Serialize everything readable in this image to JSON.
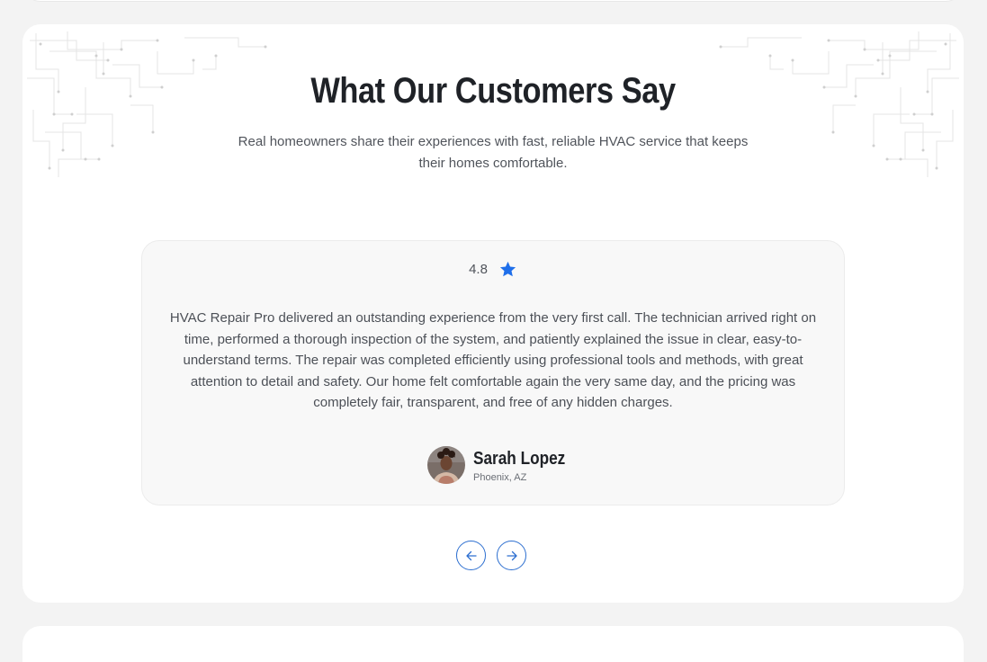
{
  "section": {
    "title": "What Our Customers Say",
    "subtitle": "Real homeowners share their experiences with fast, reliable HVAC service that keeps their homes comfortable."
  },
  "testimonial": {
    "rating": "4.8",
    "rating_icon": "star-icon",
    "quote": "HVAC Repair Pro delivered an outstanding experience from the very first call. The technician arrived right on time, performed a thorough inspection of the system, and patiently explained the issue in clear, easy-to-understand terms. The repair was completed efficiently using professional tools and methods, with great attention to detail and safety. Our home felt comfortable again the very same day, and the pricing was completely fair, transparent, and free of any hidden charges.",
    "author": {
      "name": "Sarah Lopez",
      "location": "Phoenix, AZ"
    }
  },
  "navigation": {
    "prev_icon": "arrow-left-icon",
    "next_icon": "arrow-right-icon"
  },
  "colors": {
    "accent": "#1f6fea",
    "title": "#1f2227",
    "body_text": "#50545b",
    "page_background": "#f3f3f3",
    "card_background": "#f8f8f8"
  }
}
